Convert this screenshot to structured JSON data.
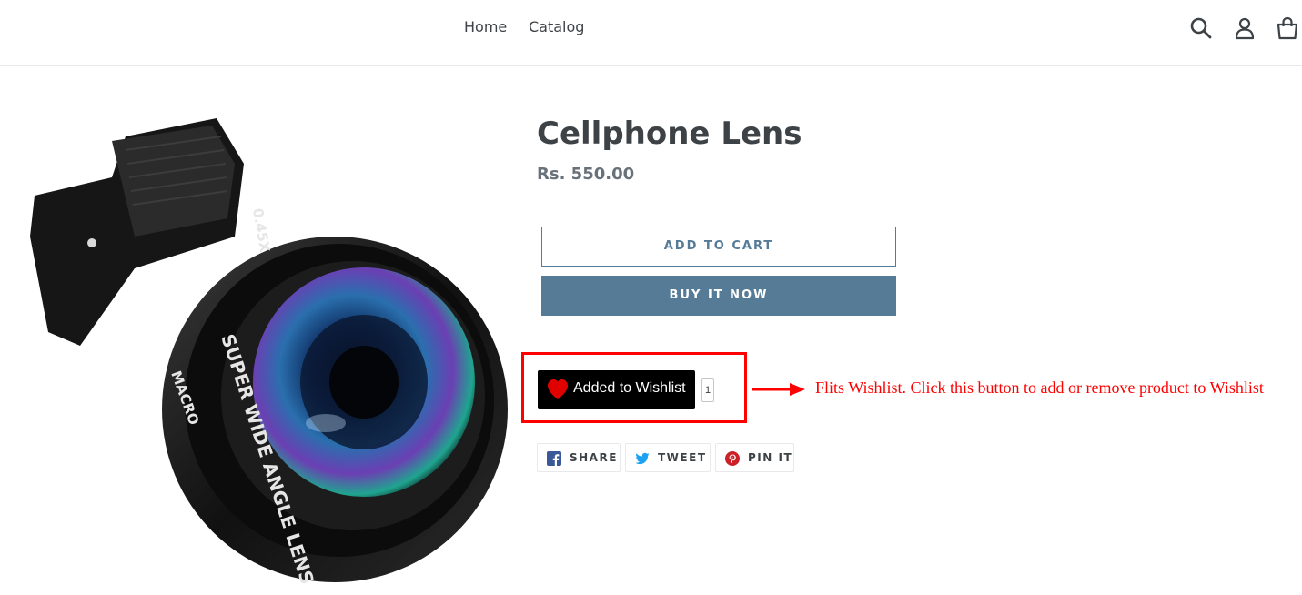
{
  "nav": {
    "home": "Home",
    "catalog": "Catalog"
  },
  "header_icons": [
    "search-icon",
    "account-icon",
    "cart-icon"
  ],
  "product": {
    "title": "Cellphone Lens",
    "price": "Rs. 550.00",
    "image_alt": "Cellphone clip lens — 0.45X Super Wide Angle Lens with Macro"
  },
  "buttons": {
    "add_to_cart": "ADD TO CART",
    "buy_now": "BUY IT NOW"
  },
  "wishlist": {
    "label": "Added to Wishlist",
    "count": "1"
  },
  "annotation": "Flits Wishlist. Click this button to add or remove product to Wishlist",
  "share": {
    "facebook": "SHARE",
    "twitter": "TWEET",
    "pinterest": "PIN IT"
  },
  "colors": {
    "accent": "#557b97",
    "text": "#3d4246",
    "price": "#69727b",
    "annotation": "#ff0000",
    "heart": "#e00000"
  }
}
